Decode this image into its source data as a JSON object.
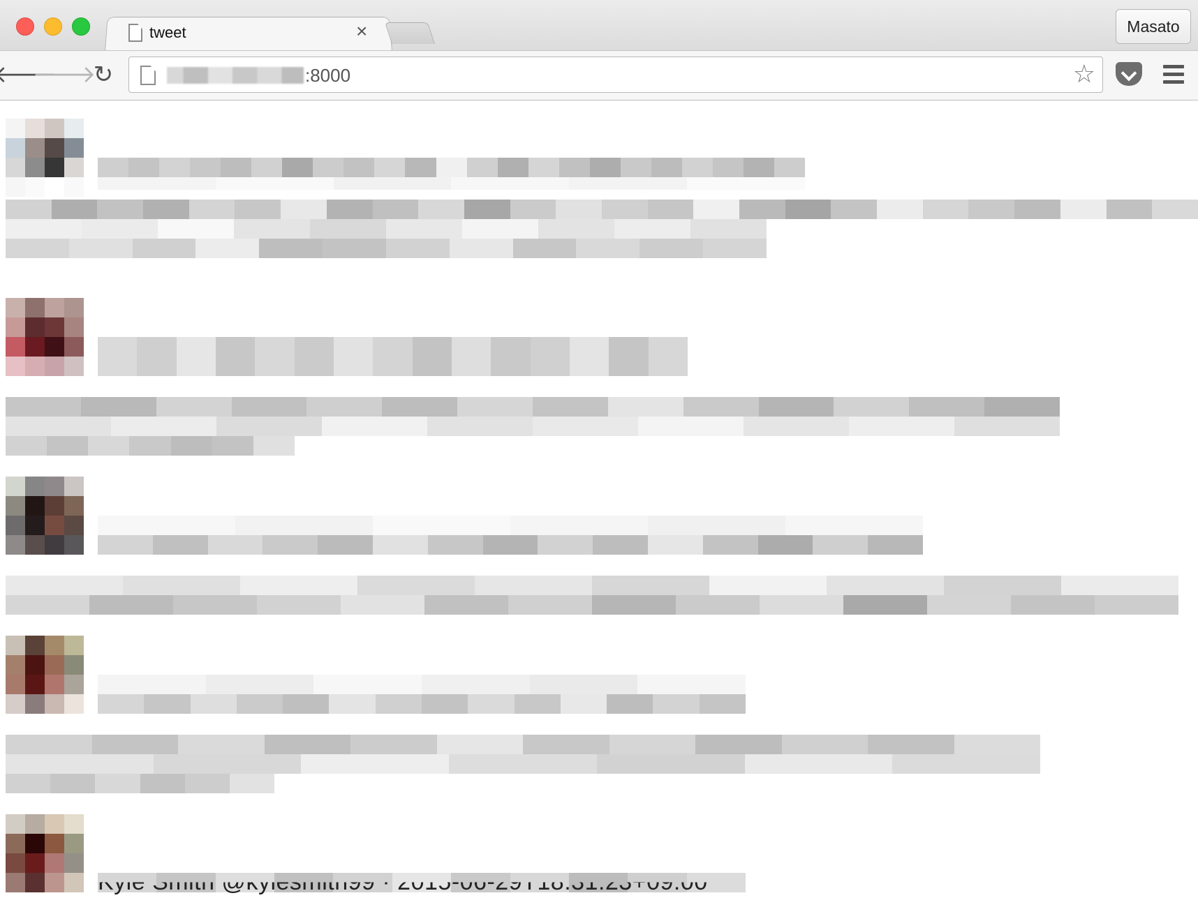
{
  "browser": {
    "tab_title": "tweet",
    "tab_close": "×",
    "profile_name": "Masato",
    "url_port": ":8000",
    "back_glyph": "🡐",
    "forward_glyph": "🡒",
    "reload_glyph": "↻",
    "star_glyph": "☆"
  },
  "feed": {
    "last_meta_line": "Kyle Smith @kylesmith99 · 2015-06-29T18:31:23+09:00"
  },
  "colors": {
    "chrome_bg": "#ececec",
    "toolbar_bg": "#f6f6f6",
    "page_bg": "#ffffff"
  }
}
